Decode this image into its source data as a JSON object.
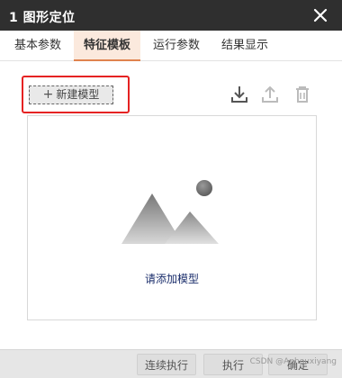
{
  "window": {
    "title": "1 图形定位",
    "close_icon": "close-icon"
  },
  "tabs": [
    {
      "label": "基本参数",
      "active": false
    },
    {
      "label": "特征模板",
      "active": true
    },
    {
      "label": "运行参数",
      "active": false
    },
    {
      "label": "结果显示",
      "active": false
    }
  ],
  "toolbar": {
    "new_model_label": "新建模型",
    "new_model_icon": "plus-icon",
    "import_icon": "download-icon",
    "export_icon": "upload-icon",
    "delete_icon": "trash-icon"
  },
  "canvas": {
    "placeholder_icon": "image-placeholder-icon",
    "hint": "请添加模型"
  },
  "footer": {
    "buttons": [
      "连续执行",
      "执行",
      "确定"
    ],
    "watermark": "CSDN @Anhouxiyang"
  },
  "colors": {
    "titlebar": "#2f2f2f",
    "active_tab_bg": "#fbe9dd",
    "active_tab_border": "#e0834f",
    "highlight_box": "#e52222",
    "hint_text": "#1a2d6b"
  }
}
